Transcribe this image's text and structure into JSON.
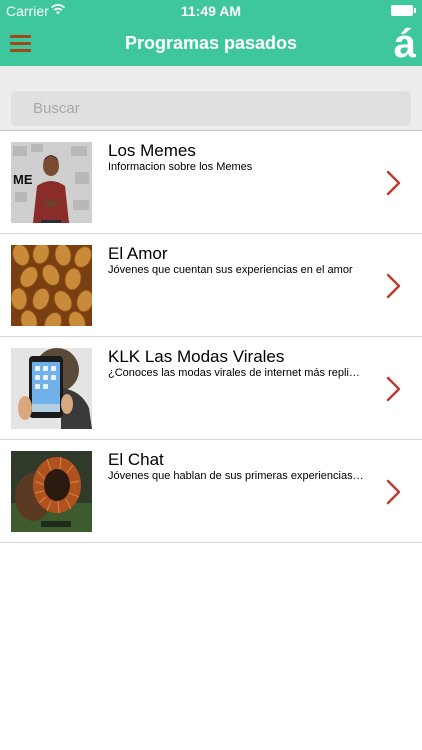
{
  "status_bar": {
    "carrier": "Carrier",
    "time": "11:49 AM"
  },
  "nav": {
    "title": "Programas pasados",
    "logo": "á",
    "menu_icon": "hamburger-icon"
  },
  "search": {
    "placeholder": "Buscar",
    "value": ""
  },
  "programs": [
    {
      "title": "Los Memes",
      "description": "Informacion sobre los Memes",
      "thumbnail": "man-presenting-memes",
      "thumb_text": "ME"
    },
    {
      "title": "El Amor",
      "description": "Jóvenes que cuentan sus experiencias en el amor",
      "thumbnail": "almonds"
    },
    {
      "title": "KLK Las Modas Virales",
      "description": "¿Conoces las modas virales de internet más replica…",
      "thumbnail": "person-holding-tablet"
    },
    {
      "title": "El Chat",
      "description": "Jóvenes que hablan de sus primeras experiencias c…",
      "thumbnail": "copper-coil"
    }
  ],
  "colors": {
    "header": "#3ec79d",
    "menu_icon": "#a2491c",
    "chevron": "#c0392b",
    "search_bg": "#ededed"
  }
}
